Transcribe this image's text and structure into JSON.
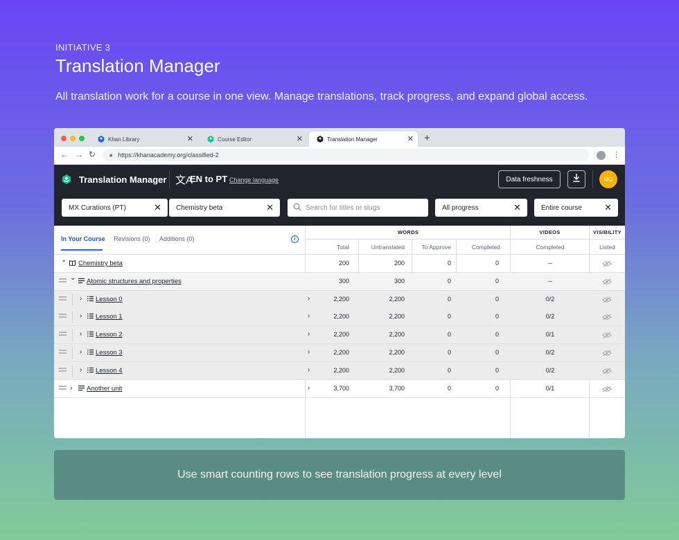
{
  "hero": {
    "eyebrow": "INITIATIVE 3",
    "title": "Translation Manager",
    "subtitle": "All translation work for a course in one view. Manage translations, track progress, and expand global access."
  },
  "browser": {
    "tabs": [
      {
        "label": "Khan Library",
        "icon": "khan-hex-icon",
        "active": false
      },
      {
        "label": "Course Editor",
        "icon": "khan-hex-icon",
        "active": false
      },
      {
        "label": "Translation Manager",
        "icon": "khan-hex-icon",
        "active": true
      }
    ],
    "new_tab": "+",
    "url": "https://khanacademy.org/classified-2"
  },
  "app": {
    "title": "Translation Manager",
    "language_pair": "EN to PT",
    "change_language": "Change language",
    "data_freshness": "Data freshness",
    "avatar_initials": "MG",
    "filters": {
      "curation": "MX Curations (PT)",
      "course": "Chemistry beta",
      "search_placeholder": "Search for titles or slugs",
      "progress": "All progress",
      "scope": "Entire course"
    },
    "left_tabs": [
      "In Your Course",
      "Revisions (0)",
      "Additions (0)"
    ],
    "column_groups": {
      "words": "WORDS",
      "videos": "VIDEOS",
      "visibility": "VISIBILITY"
    },
    "columns": {
      "total": "Total",
      "untranslated": "Untranslated",
      "to_approve": "To Approve",
      "completed": "Completed",
      "videos_completed": "Completed",
      "listed": "Listed"
    },
    "rows": [
      {
        "title": "Chemistry beta",
        "level": "course",
        "total": "200",
        "untranslated": "200",
        "to_approve": "0",
        "completed": "0",
        "videos": "--",
        "listed": "hidden"
      },
      {
        "title": "Atomic structures and properties",
        "level": "unit",
        "total": "300",
        "untranslated": "300",
        "to_approve": "0",
        "completed": "0",
        "videos": "--",
        "listed": "hidden"
      },
      {
        "title": "Lesson 0",
        "level": "lesson",
        "total": "2,200",
        "untranslated": "2,200",
        "to_approve": "0",
        "completed": "0",
        "videos": "0/2",
        "listed": "hidden"
      },
      {
        "title": "Lesson 1",
        "level": "lesson",
        "total": "2,200",
        "untranslated": "2,200",
        "to_approve": "0",
        "completed": "0",
        "videos": "0/2",
        "listed": "hidden"
      },
      {
        "title": "Lesson 2",
        "level": "lesson",
        "total": "2,200",
        "untranslated": "2,200",
        "to_approve": "0",
        "completed": "0",
        "videos": "0/1",
        "listed": "hidden"
      },
      {
        "title": "Lesson 3",
        "level": "lesson",
        "total": "2,200",
        "untranslated": "2,200",
        "to_approve": "0",
        "completed": "0",
        "videos": "0/2",
        "listed": "hidden"
      },
      {
        "title": "Lesson 4",
        "level": "lesson",
        "total": "2,200",
        "untranslated": "2,200",
        "to_approve": "0",
        "completed": "0",
        "videos": "0/2",
        "listed": "hidden"
      },
      {
        "title": "Another unit",
        "level": "unit-collapsed",
        "total": "3,700",
        "untranslated": "3,700",
        "to_approve": "0",
        "completed": "0",
        "videos": "0/1",
        "listed": "hidden"
      }
    ]
  },
  "caption": "Use smart counting rows to see translation progress at every level",
  "colors": {
    "brand": "#6a45f5",
    "appbar": "#21242c",
    "accent": "#1865f2",
    "avatar": "#ffb100",
    "khan_green": "#14bf96"
  }
}
